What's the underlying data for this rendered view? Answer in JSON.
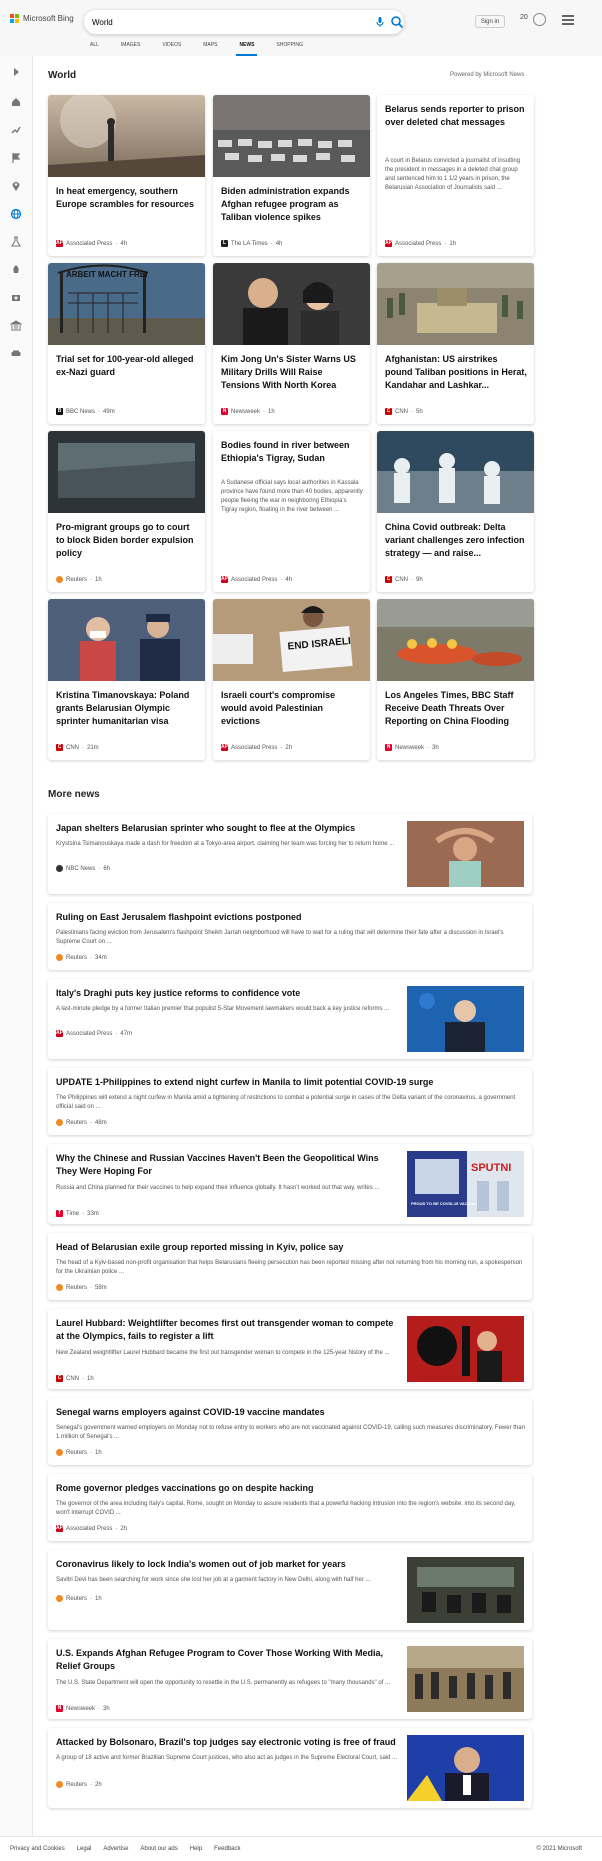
{
  "header": {
    "logo_text": "Microsoft Bing",
    "search_value": "World",
    "signin_label": "Sign in",
    "reward_count": "20",
    "tabs": [
      "ALL",
      "IMAGES",
      "VIDEOS",
      "MAPS",
      "NEWS",
      "SHOPPING"
    ],
    "active_tab": "NEWS"
  },
  "section": {
    "title": "World",
    "powered": "Powered by Microsoft News"
  },
  "cards": [
    {
      "title": "In heat emergency, southern Europe scrambles for resources",
      "source": "Associated Press",
      "age": "4h"
    },
    {
      "title": "Biden administration expands Afghan refugee program as Taliban violence spikes",
      "source": "The LA Times",
      "age": "4h"
    },
    {
      "title": "Belarus sends reporter to prison over deleted chat messages",
      "desc": "A court in Belarus convicted a journalist of insulting the president in messages in a deleted chat group and sentenced him to 1 1/2 years in prison, the Belarusian Association of Journalists said ...",
      "source": "Associated Press",
      "age": "1h"
    },
    {
      "title": "Trial set for 100-year-old alleged ex-Nazi guard",
      "source": "BBC News",
      "age": "49m"
    },
    {
      "title": "Kim Jong Un's Sister Warns US Military Drills Will Raise Tensions With North Korea",
      "source": "Newsweek",
      "age": "1h"
    },
    {
      "title": "Afghanistan: US airstrikes pound Taliban positions in Herat, Kandahar and Lashkar...",
      "source": "CNN",
      "age": "5h"
    },
    {
      "title": "Pro-migrant groups go to court to block Biden border expulsion policy",
      "source": "Reuters",
      "age": "1h"
    },
    {
      "title": "Bodies found in river between Ethiopia's Tigray, Sudan",
      "desc": "A Sudanese official says local authorities in Kassala province have found more than 40 bodies, apparently people fleeing the war in neighboring Ethiopia's Tigray region, floating in the river between ...",
      "source": "Associated Press",
      "age": "4h"
    },
    {
      "title": "China Covid outbreak: Delta variant challenges zero infection strategy — and raise...",
      "source": "CNN",
      "age": "9h"
    },
    {
      "title": "Kristina Timanovskaya: Poland grants Belarusian Olympic sprinter humanitarian visa",
      "source": "CNN",
      "age": "21m"
    },
    {
      "title": "Israeli court's compromise would avoid Palestinian evictions",
      "source": "Associated Press",
      "age": "2h"
    },
    {
      "title": "Los Angeles Times, BBC Staff Receive Death Threats Over Reporting on China Flooding",
      "source": "Newsweek",
      "age": "3h"
    }
  ],
  "card_image_text": {
    "arbeit": "ARBEIT MACHT FREI",
    "sign": "END ISRAELI",
    "vaccine": "SPUTNI",
    "vaccine_sub": "PROUD TO BE COVID-19 VACCINATED"
  },
  "more_news": {
    "title": "More news",
    "items": [
      {
        "title": "Japan shelters Belarusian sprinter who sought to flee at the Olympics",
        "desc": "Krystsina Tsimanouskaya made a dash for freedom at a Tokyo-area airport, claiming her team was forcing her to return home ...",
        "source": "NBC News",
        "age": "6h"
      },
      {
        "title": "Ruling on East Jerusalem flashpoint evictions postponed",
        "desc": "Palestinians facing eviction from Jerusalem's flashpoint Sheikh Jarrah neighborhood will have to wait for a ruling that will determine their fate after a discussion in Israel's Supreme Court on ...",
        "source": "Reuters",
        "age": "34m"
      },
      {
        "title": "Italy's Draghi puts key justice reforms to confidence vote",
        "desc": "A last-minute pledge by a former Italian premier that populist 5-Star Movement lawmakers would back a key justice reforms ...",
        "source": "Associated Press",
        "age": "47m"
      },
      {
        "title": "UPDATE 1-Philippines to extend night curfew in Manila to limit potential COVID-19 surge",
        "desc": "The Philippines will extend a night curfew in Manila amid a tightening of restrictions to combat a potential surge in cases of the Delta variant of the coronavirus, a government official said on ...",
        "source": "Reuters",
        "age": "48m"
      },
      {
        "title": "Why the Chinese and Russian Vaccines Haven't Been the Geopolitical Wins They Were Hoping For",
        "desc": "Russia and China planned for their vaccines to help expand their influence globally. It hasn't worked out that way, writes ...",
        "source": "Time",
        "age": "33m"
      },
      {
        "title": "Head of Belarusian exile group reported missing in Kyiv, police say",
        "desc": "The head of a Kyiv-based non-profit organisation that helps Belarusians fleeing persecution has been reported missing after not returning from his morning run, a spokesperson for the Ukrainian police ...",
        "source": "Reuters",
        "age": "58m"
      },
      {
        "title": "Laurel Hubbard: Weightlifter becomes first out transgender woman to compete at the Olympics, fails to register a lift",
        "desc": "New Zealand weightlifter Laurel Hubbard became the first out transgender woman to compete in the 125-year history of the ...",
        "source": "CNN",
        "age": "1h"
      },
      {
        "title": "Senegal warns employers against COVID-19 vaccine mandates",
        "desc": "Senegal's government warned employers on Monday not to refuse entry to workers who are not vaccinated against COVID-19, calling such measures discriminatory. Fewer than 1 million of Senegal's ...",
        "source": "Reuters",
        "age": "1h"
      },
      {
        "title": "Rome governor pledges vaccinations go on despite hacking",
        "desc": "The governor of the area including Italy's capital, Rome, sought on Monday to assure residents that a powerful hacking intrusion into the region's website, into its second day, won't interrupt COVID ...",
        "source": "Associated Press",
        "age": "2h"
      },
      {
        "title": "Coronavirus likely to lock India's women out of job market for years",
        "desc": "Savitri Devi has been searching for work since she lost her job at a garment factory in New Delhi, along with half her ...",
        "source": "Reuters",
        "age": "1h"
      },
      {
        "title": "U.S. Expands Afghan Refugee Program to Cover Those Working With Media, Relief Groups",
        "desc": "The U.S. State Department will open the opportunity to resettle in the U.S. permanently as refugees to \"many thousands\" of ...",
        "source": "Newsweek",
        "age": "3h"
      },
      {
        "title": "Attacked by Bolsonaro, Brazil's top judges say electronic voting is free of fraud",
        "desc": "A group of 18 active and former Brazilian Supreme Court justices, who also act as judges in the Supreme Electoral Court, said ...",
        "source": "Reuters",
        "age": "2h"
      }
    ]
  },
  "footer": {
    "links": [
      "Privacy and Cookies",
      "Legal",
      "Advertise",
      "About our ads",
      "Help",
      "Feedback"
    ],
    "copyright": "© 2021 Microsoft"
  },
  "colors": {
    "accent": "#0078d4",
    "ap": "#d0021b",
    "cnn": "#cc0000",
    "reuters": "#f08a24",
    "newsweek": "#e4002b"
  }
}
